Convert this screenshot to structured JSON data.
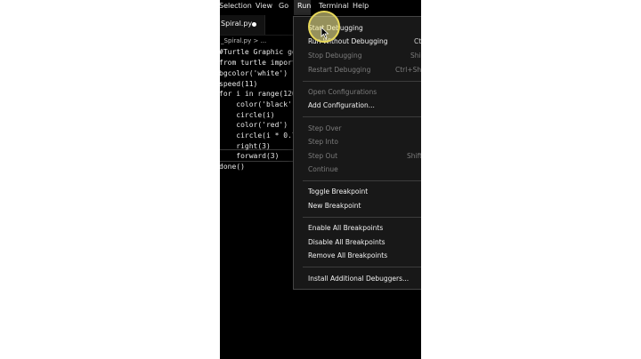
{
  "menubar": {
    "items": [
      "Selection",
      "View",
      "Go",
      "Run",
      "Terminal",
      "Help"
    ],
    "active": "Run"
  },
  "editor": {
    "tab_label": "Spiral.py",
    "breadcrumb": "_Spiral.py > ...",
    "code_lines": [
      "#Turtle Graphic ge",
      "from turtle import",
      "bgcolor('white')",
      "speed(11)",
      "for i in range(120",
      "    color('black')",
      "    circle(i)",
      "    color('red')",
      "    circle(i * 0.7",
      "    right(3)",
      "    forward(3)",
      "done()"
    ]
  },
  "run_menu": {
    "items": [
      {
        "label": "Start Debugging",
        "enabled": true,
        "shortcut": ""
      },
      {
        "label": "Run Without Debugging",
        "enabled": true,
        "shortcut": "Ct"
      },
      {
        "label": "Stop Debugging",
        "enabled": false,
        "shortcut": "Shi"
      },
      {
        "label": "Restart Debugging",
        "enabled": false,
        "shortcut": "Ctrl+Shi"
      },
      {
        "label": "Open Configurations",
        "enabled": false,
        "shortcut": ""
      },
      {
        "label": "Add Configuration...",
        "enabled": true,
        "shortcut": ""
      },
      {
        "label": "Step Over",
        "enabled": false,
        "shortcut": ""
      },
      {
        "label": "Step Into",
        "enabled": false,
        "shortcut": ""
      },
      {
        "label": "Step Out",
        "enabled": false,
        "shortcut": "Shift"
      },
      {
        "label": "Continue",
        "enabled": false,
        "shortcut": ""
      },
      {
        "label": "Toggle Breakpoint",
        "enabled": true,
        "shortcut": ""
      },
      {
        "label": "New Breakpoint",
        "enabled": true,
        "shortcut": ""
      },
      {
        "label": "Enable All Breakpoints",
        "enabled": true,
        "shortcut": ""
      },
      {
        "label": "Disable All Breakpoints",
        "enabled": true,
        "shortcut": ""
      },
      {
        "label": "Remove All Breakpoints",
        "enabled": true,
        "shortcut": ""
      },
      {
        "label": "Install Additional Debuggers...",
        "enabled": true,
        "shortcut": ""
      }
    ]
  },
  "colors": {
    "background": "#000000",
    "menu_bg": "#181818",
    "text": "#f0f0f0",
    "disabled_text": "#7c7c7c",
    "highlight": "#e7d85a"
  }
}
